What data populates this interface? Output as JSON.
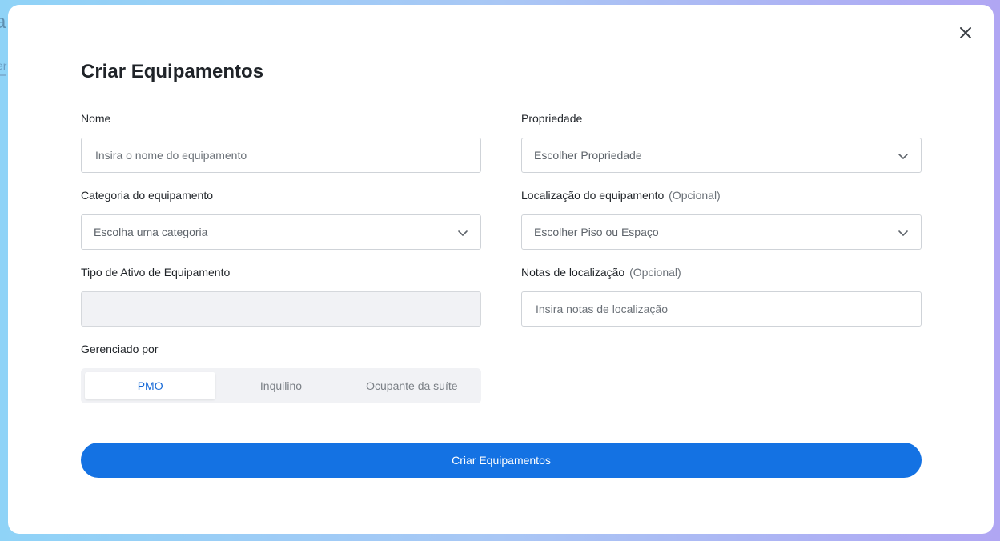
{
  "background": {
    "title_fragment": "a",
    "tab_fragment": "er"
  },
  "modal": {
    "title": "Criar Equipamentos",
    "close_icon": "close-icon",
    "fields": {
      "nome": {
        "label": "Nome",
        "placeholder": "Insira o nome do equipamento",
        "value": ""
      },
      "propriedade": {
        "label": "Propriedade",
        "selected": "Escolher Propriedade"
      },
      "categoria": {
        "label": "Categoria do equipamento",
        "selected": "Escolha uma categoria"
      },
      "localizacao": {
        "label": "Localização do equipamento",
        "optional": "(Opcional)",
        "selected": "Escolher Piso ou Espaço"
      },
      "tipo_ativo": {
        "label": "Tipo de Ativo de Equipamento",
        "value": ""
      },
      "notas": {
        "label": "Notas de localização",
        "optional": "(Opcional)",
        "placeholder": "Insira notas de localização",
        "value": ""
      },
      "gerenciado": {
        "label": "Gerenciado por",
        "options": [
          "PMO",
          "Inquilino",
          "Ocupante da suíte"
        ],
        "selected": "PMO"
      }
    },
    "submit_label": "Criar Equipamentos"
  },
  "colors": {
    "primary": "#1472e3",
    "active_segment_text": "#1769d6",
    "disabled_bg": "#f1f2f5"
  }
}
